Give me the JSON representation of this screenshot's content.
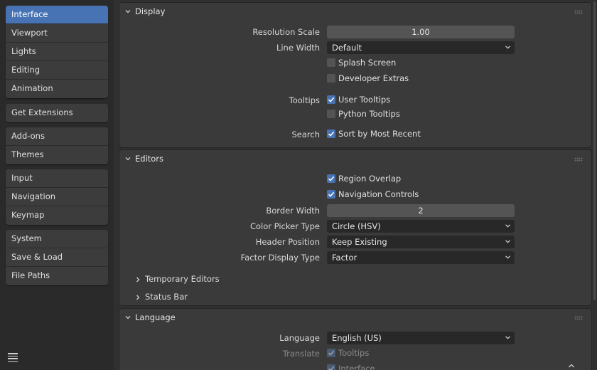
{
  "sidebar": {
    "groups": [
      [
        "Interface",
        "Viewport",
        "Lights",
        "Editing",
        "Animation"
      ],
      [
        "Get Extensions"
      ],
      [
        "Add-ons",
        "Themes"
      ],
      [
        "Input",
        "Navigation",
        "Keymap"
      ],
      [
        "System",
        "Save & Load",
        "File Paths"
      ]
    ],
    "active": "Interface"
  },
  "display": {
    "title": "Display",
    "resolution_scale": {
      "label": "Resolution Scale",
      "value": "1.00"
    },
    "line_width": {
      "label": "Line Width",
      "value": "Default"
    },
    "splash_screen": {
      "label": "Splash Screen",
      "checked": false
    },
    "developer_extras": {
      "label": "Developer Extras",
      "checked": false
    },
    "tooltips_label": "Tooltips",
    "user_tooltips": {
      "label": "User Tooltips",
      "checked": true
    },
    "python_tooltips": {
      "label": "Python Tooltips",
      "checked": false
    },
    "search_label": "Search",
    "sort_recent": {
      "label": "Sort by Most Recent",
      "checked": true
    }
  },
  "editors": {
    "title": "Editors",
    "region_overlap": {
      "label": "Region Overlap",
      "checked": true
    },
    "navigation_controls": {
      "label": "Navigation Controls",
      "checked": true
    },
    "border_width": {
      "label": "Border Width",
      "value": "2"
    },
    "color_picker": {
      "label": "Color Picker Type",
      "value": "Circle (HSV)"
    },
    "header_position": {
      "label": "Header Position",
      "value": "Keep Existing"
    },
    "factor_display": {
      "label": "Factor Display Type",
      "value": "Factor"
    },
    "temporary_editors": "Temporary Editors",
    "status_bar": "Status Bar"
  },
  "language": {
    "title": "Language",
    "language": {
      "label": "Language",
      "value": "English (US)"
    },
    "translate_label": "Translate",
    "tooltips": {
      "label": "Tooltips",
      "checked": true
    },
    "interface": {
      "label": "Interface",
      "checked": true
    }
  },
  "colors": {
    "accent": "#4772b3",
    "panel": "#3a3a3a",
    "background": "#303030"
  }
}
